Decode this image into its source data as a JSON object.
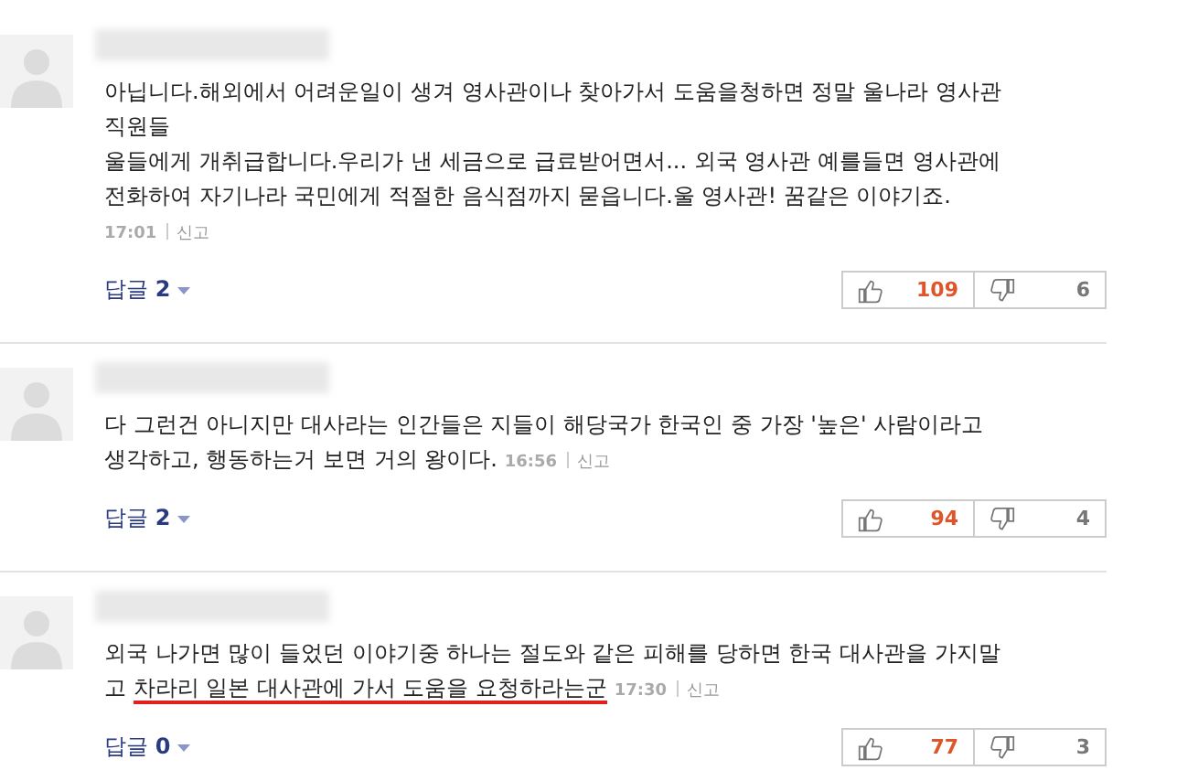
{
  "comments": [
    {
      "lines": [
        [
          {
            "kind": "text",
            "text": "아닙니다.해외에서 어려운일이 생겨 영사관이나 찾아가서 도움을청하면 정말 울나라 영사관"
          }
        ],
        [
          {
            "kind": "text",
            "text": "직원들"
          }
        ],
        [
          {
            "kind": "text",
            "text": "울들에게 개취급합니다.우리가 낸 세금으로 급료받어면서... 외국 영사관 예를들면 영사관에"
          }
        ],
        [
          {
            "kind": "text",
            "text": "전화하여 자기나라 국민에게 적절한 음식점까지 묻읍니다.울 영사관! 꿈같은 이야기죠."
          }
        ],
        [
          {
            "kind": "time",
            "text": "17:01"
          },
          {
            "kind": "report",
            "text": "신고"
          }
        ]
      ],
      "reply_label": "답글",
      "reply_count": "2",
      "likes": "109",
      "dislikes": "6"
    },
    {
      "lines": [
        [
          {
            "kind": "text",
            "text": "다 그런건 아니지만 대사라는 인간들은 지들이 해당국가 한국인 중 가장 '높은' 사람이라고"
          }
        ],
        [
          {
            "kind": "text",
            "text": "생각하고, 행동하는거 보면 거의 왕이다."
          },
          {
            "kind": "time",
            "text": "16:56"
          },
          {
            "kind": "report",
            "text": "신고"
          }
        ]
      ],
      "reply_label": "답글",
      "reply_count": "2",
      "likes": "94",
      "dislikes": "4"
    },
    {
      "lines": [
        [
          {
            "kind": "text",
            "text": "외국 나가면 많이 들었던 이야기중 하나는 절도와 같은 피해를 당하면 한국 대사관을 가지말"
          }
        ],
        [
          {
            "kind": "text",
            "text": "고 "
          },
          {
            "kind": "underlined",
            "text": "차라리 일본 대사관에 가서 도움을 요청하라는군"
          },
          {
            "kind": "time",
            "text": "17:30"
          },
          {
            "kind": "report",
            "text": "신고"
          }
        ]
      ],
      "reply_label": "답글",
      "reply_count": "0",
      "likes": "77",
      "dislikes": "3"
    }
  ]
}
